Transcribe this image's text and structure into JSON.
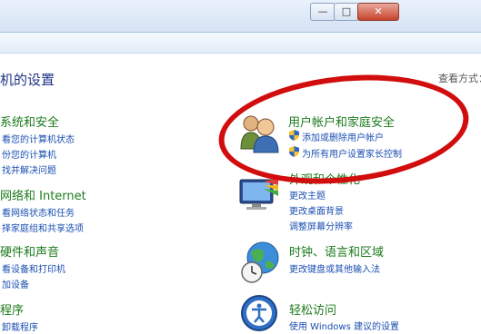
{
  "window": {
    "min_label": "",
    "max_label": "",
    "close_label": ""
  },
  "header": {
    "page_title": "机的设置",
    "view_by": "查看方式："
  },
  "left_categories": [
    {
      "title": "系统和安全",
      "links": [
        "看您的计算机状态",
        "份您的计算机",
        "找并解决问题"
      ]
    },
    {
      "title": "网络和 Internet",
      "links": [
        "看网络状态和任务",
        "择家庭组和共享选项"
      ]
    },
    {
      "title": "硬件和声音",
      "links": [
        "看设备和打印机",
        "加设备"
      ]
    },
    {
      "title": "程序",
      "links": [
        "卸载程序"
      ]
    }
  ],
  "right_categories": [
    {
      "title": "用户帐户和家庭安全",
      "links": [
        "添加或删除用户帐户",
        "为所有用户设置家长控制"
      ],
      "icon": "users-icon"
    },
    {
      "title": "外观和个性化",
      "links": [
        "更改主题",
        "更改桌面背景",
        "调整屏幕分辨率"
      ],
      "icon": "appearance-icon"
    },
    {
      "title": "时钟、语言和区域",
      "links": [
        "更改键盘或其他输入法"
      ],
      "icon": "clock-globe-icon"
    },
    {
      "title": "轻松访问",
      "links": [
        "使用 Windows 建议的设置"
      ],
      "icon": "ease-of-access-icon"
    }
  ],
  "colors": {
    "category_title": "#1c7a1c",
    "link": "#1a4fb2",
    "heading": "#1e3287",
    "annotation": "#d10d0d"
  }
}
